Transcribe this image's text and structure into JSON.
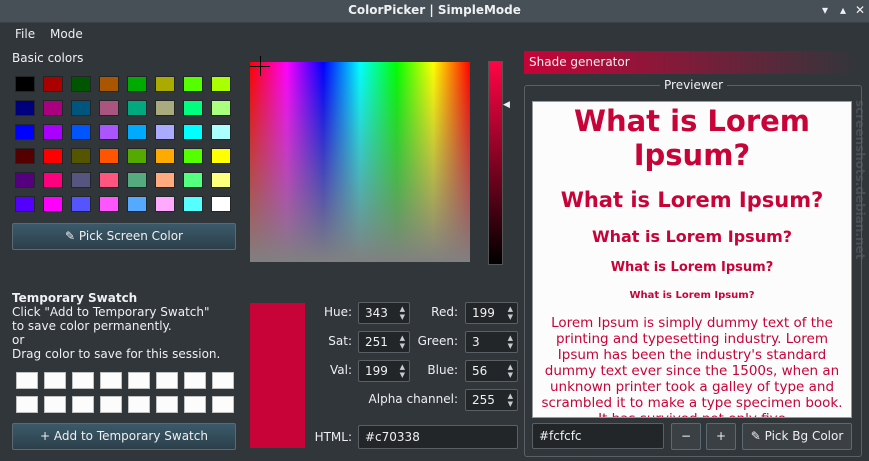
{
  "window": {
    "title": "ColorPicker | SimpleMode"
  },
  "menu": {
    "file": "File",
    "mode": "Mode"
  },
  "basic_colors": {
    "label": "Basic colors",
    "rows": [
      [
        "#000000",
        "#aa0000",
        "#005500",
        "#aa5500",
        "#00aa00",
        "#aaaa00",
        "#55ff00",
        "#aaff00"
      ],
      [
        "#00007f",
        "#aa007f",
        "#00557f",
        "#aa557f",
        "#00aa7f",
        "#aaaa7f",
        "#00ff7f",
        "#aaff7f"
      ],
      [
        "#0000ff",
        "#aa00ff",
        "#0055ff",
        "#aa55ff",
        "#00aaff",
        "#aaaaff",
        "#00ffff",
        "#aaffff"
      ],
      [
        "#550000",
        "#ff0000",
        "#555500",
        "#ff5500",
        "#55aa00",
        "#ffaa00",
        "#55ff00",
        "#ffff00"
      ],
      [
        "#55007f",
        "#ff007f",
        "#55557f",
        "#ff557f",
        "#55aa7f",
        "#ffaa7f",
        "#55ff7f",
        "#ffff7f"
      ],
      [
        "#5500ff",
        "#ff00ff",
        "#5555ff",
        "#ff55ff",
        "#55aaff",
        "#ffaaff",
        "#55ffff",
        "#ffffff"
      ]
    ]
  },
  "pick_screen_label": "Pick Screen Color",
  "temp_swatch": {
    "title": "Temporary Swatch",
    "line1": "Click \"Add to Temporary Swatch\"",
    "line2": "to save color permanently.",
    "line3": "or",
    "line4": "Drag color to save for this session.",
    "add_label": "Add to Temporary Swatch"
  },
  "color": {
    "current": "#c70338",
    "hue_label": "Hue:",
    "hue": "343",
    "sat_label": "Sat:",
    "sat": "251",
    "val_label": "Val:",
    "val": "199",
    "red_label": "Red:",
    "red": "199",
    "green_label": "Green:",
    "green": "3",
    "blue_label": "Blue:",
    "blue": "56",
    "alpha_label": "Alpha channel:",
    "alpha": "255",
    "html_label": "HTML:",
    "html": "#c70338"
  },
  "shade_generator": {
    "label": "Shade generator"
  },
  "previewer": {
    "label": "Previewer",
    "h1": "What is Lorem Ipsum?",
    "h2": "What is Lorem Ipsum?",
    "h3": "What is Lorem Ipsum?",
    "h4": "What is Lorem Ipsum?",
    "h5": "What is Lorem Ipsum?",
    "body": "Lorem Ipsum is simply dummy text of the printing and typesetting industry. Lorem Ipsum has been the industry's standard dummy text ever since the 1500s, when an unknown printer took a galley of type and scrambled it to make a type specimen book. It has survived not only five",
    "bg_value": "#fcfcfc",
    "minus_label": "−",
    "plus_label": "+",
    "pick_bg_label": "Pick Bg Color"
  },
  "watermark": "screenshots.debian.net"
}
